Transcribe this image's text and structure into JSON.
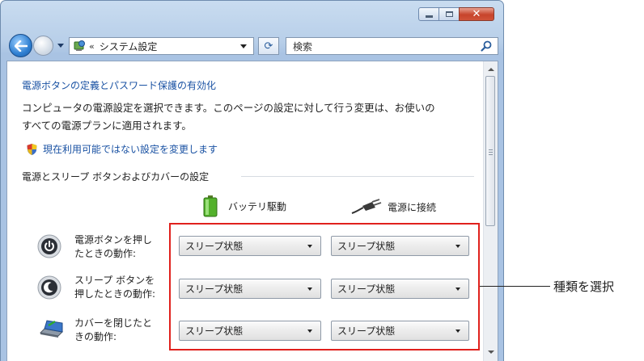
{
  "window": {
    "address_path": "システム設定",
    "address_sep": "«",
    "search_placeholder": "検索"
  },
  "content": {
    "title_link": "電源ボタンの定義とパスワード保護の有効化",
    "description_line1": "コンピュータの電源設定を選択できます。このページの設定に対して行う変更は、お使いの",
    "description_line2": "すべての電源プランに適用されます。",
    "change_settings_link": "現在利用可能ではない設定を変更します",
    "section_heading": "電源とスリープ ボタンおよびカバーの設定",
    "columns": {
      "battery": "バッテリ駆動",
      "plugged_in": "電源に接続"
    },
    "rows": [
      {
        "label_line1": "電源ボタンを押し",
        "label_line2": "たときの動作:",
        "battery": "スリープ状態",
        "plugged_in": "スリープ状態"
      },
      {
        "label_line1": "スリープ ボタンを",
        "label_line2": "押したときの動作:",
        "battery": "スリープ状態",
        "plugged_in": "スリープ状態"
      },
      {
        "label_line1": "カバーを閉じたと",
        "label_line2": "きの動作:",
        "battery": "スリープ状態",
        "plugged_in": "スリープ状態"
      }
    ]
  },
  "annotation": {
    "label": "種類を選択",
    "color": "#e0211d"
  },
  "colors": {
    "link": "#1a52a3",
    "frame": "#b8cfe9"
  }
}
